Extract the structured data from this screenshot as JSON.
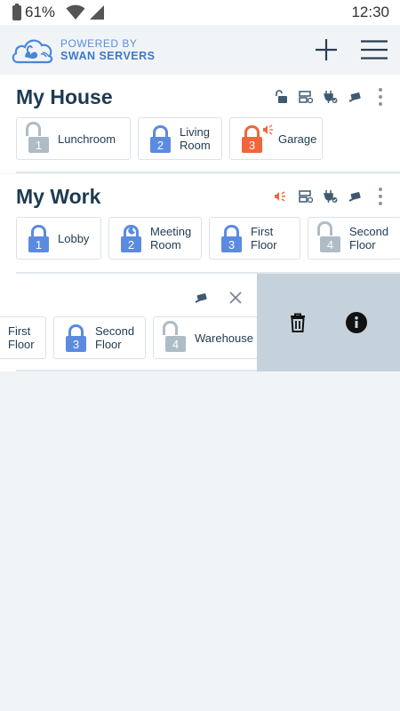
{
  "status_bar": {
    "battery": "61%",
    "time": "12:30"
  },
  "logo": {
    "line1": "POWERED BY",
    "line2": "SWAN SERVERS"
  },
  "groups": [
    {
      "title": "My House",
      "locks": [
        {
          "number": "1",
          "label": "Lunchroom"
        },
        {
          "number": "2",
          "label": "Living Room"
        },
        {
          "number": "3",
          "label": "Garage"
        }
      ]
    },
    {
      "title": "My Work",
      "locks": [
        {
          "number": "1",
          "label": "Lobby"
        },
        {
          "number": "2",
          "label": "Meeting Room"
        },
        {
          "number": "3",
          "label": "First Floor"
        },
        {
          "number": "4",
          "label": "Second Floor"
        }
      ]
    },
    {
      "title": "",
      "locks": [
        {
          "number": "",
          "label": "First Floor"
        },
        {
          "number": "3",
          "label": "Second Floor"
        },
        {
          "number": "4",
          "label": "Warehouse"
        }
      ]
    }
  ],
  "colors": {
    "locked": "#5b8be0",
    "unlocked": "#aebcc6",
    "alarm": "#f0663a",
    "title": "#1e3a52",
    "swipe_bg": "#c6d2db"
  }
}
